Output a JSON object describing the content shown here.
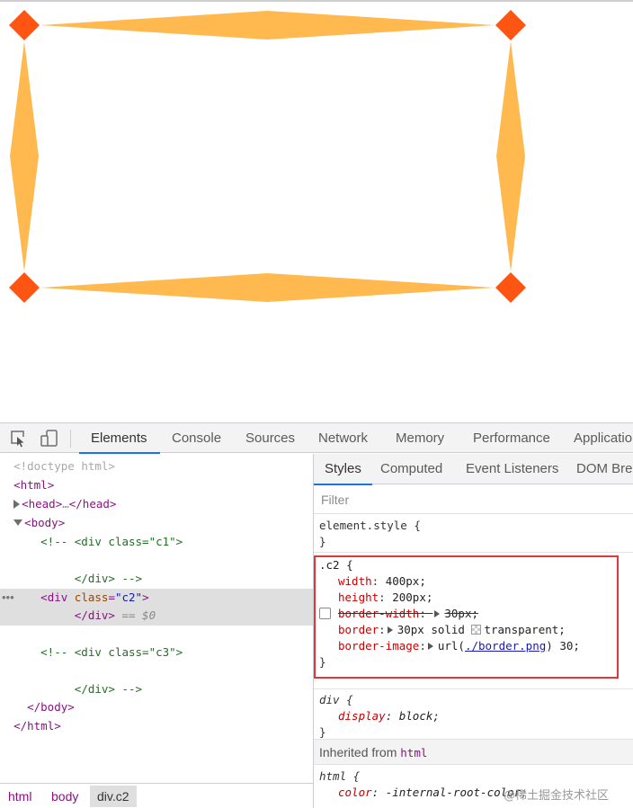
{
  "colors": {
    "border_fill": "#ffb94f",
    "corner_fill": "#ff5513",
    "active_tab": "#1a73e8",
    "highlight": "#e5343a"
  },
  "toolbar": {
    "inspect_icon": "inspect-cursor-icon",
    "device_icon": "device-toggle-icon",
    "tabs": [
      "Elements",
      "Console",
      "Sources",
      "Network",
      "Memory",
      "Performance",
      "Applicatio"
    ]
  },
  "dom": {
    "doctype": "<!doctype html>",
    "html_open": "<html>",
    "head_open": "<head>",
    "head_ellipsis": "…",
    "head_close": "</head>",
    "body_open": "<body>",
    "comment1_open": "<!-- <div class=\"c1\">",
    "comment1_close": "</div> -->",
    "div_tag": "div",
    "div_attr": "class",
    "div_val": "\"c2\"",
    "div_close": "</div>",
    "dollar": " == $0",
    "comment3_open": "<!-- <div class=\"c3\">",
    "comment3_close": "</div> -->",
    "body_close": "</body>",
    "html_close": "</html>",
    "dots": "•••"
  },
  "breadcrumb": [
    "html",
    "body",
    "div.c2"
  ],
  "styles": {
    "tabs": [
      "Styles",
      "Computed",
      "Event Listeners",
      "DOM Brea"
    ],
    "filter_placeholder": "Filter",
    "element_style": {
      "selector": "element.style {",
      "close": "}"
    },
    "c2_rule": {
      "selector": ".c2 {",
      "width_name": "width",
      "width_val": "400px;",
      "height_name": "height",
      "height_val": "200px;",
      "bw_name": "border-width",
      "bw_val": "30px;",
      "border_name": "border",
      "border_val1": "30px solid",
      "border_val2": "transparent;",
      "bi_name": "border-image",
      "bi_val1": "url(",
      "bi_link": "./border.png",
      "bi_val2": ") 30;",
      "close": "}"
    },
    "div_rule": {
      "selector": "div {",
      "prop": "display",
      "val": "block;",
      "close": "}"
    },
    "inherited_label": "Inherited from",
    "inherited_tag": "html",
    "html_rule": {
      "selector": "html {",
      "prop": "color",
      "val": "-internal-root-color;"
    }
  },
  "watermark": "@稀土掘金技术社区"
}
